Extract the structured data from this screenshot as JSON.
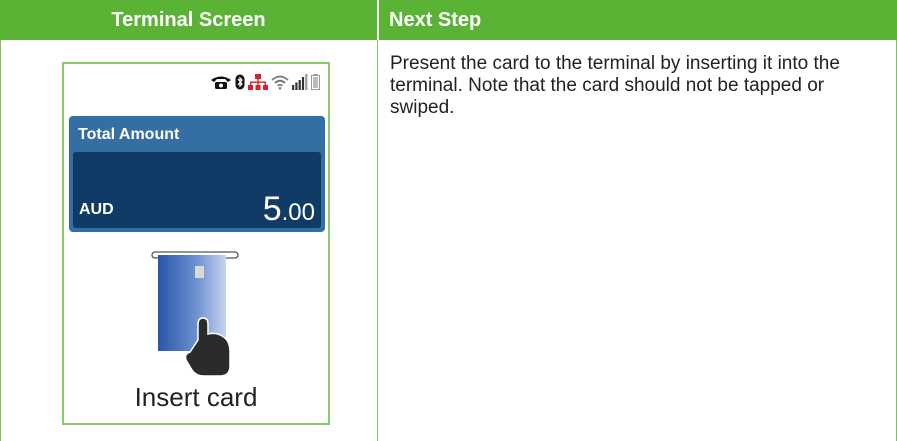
{
  "table": {
    "headers": [
      "Terminal Screen",
      "Next Step"
    ],
    "next_step_text": "Present the card to the terminal by inserting it into the terminal. Note that the card should not be tapped or swiped."
  },
  "terminal_screen": {
    "status_icons": [
      "phone-icon",
      "bluetooth-icon",
      "network-icon",
      "wifi-icon",
      "signal-icon",
      "battery-icon"
    ],
    "total_label": "Total Amount",
    "currency": "AUD",
    "amount_major": "5",
    "amount_minor": ".00",
    "instruction": "Insert card"
  },
  "colors": {
    "header_green": "#5bb336",
    "border_green": "#8ccb6a",
    "panel_blue": "#356ea2",
    "panel_dark_blue": "#0f3b66",
    "network_red": "#d6232a"
  }
}
